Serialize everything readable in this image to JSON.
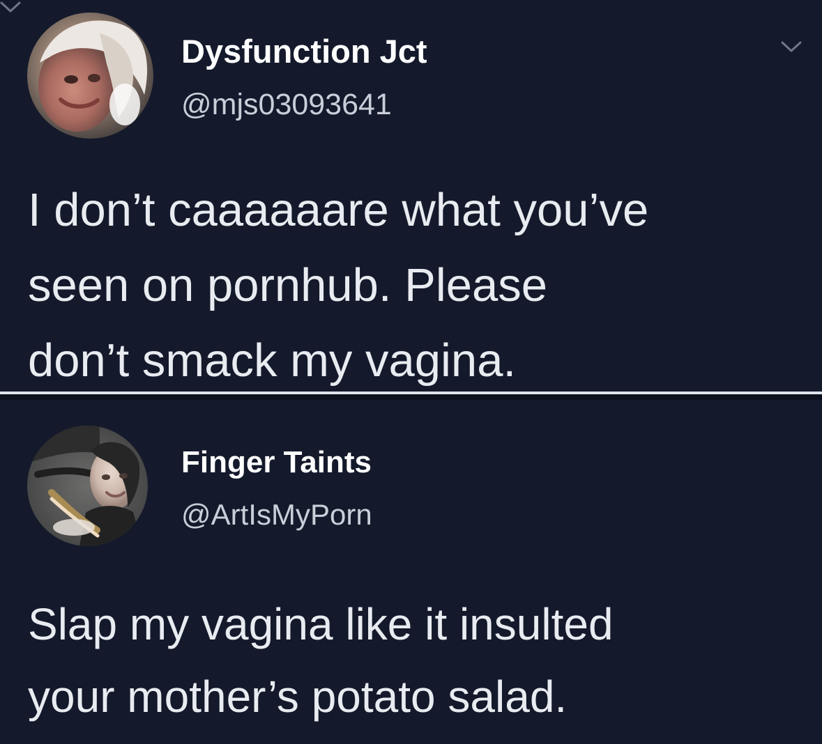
{
  "tweets": [
    {
      "display_name": "Dysfunction Jct",
      "handle": "@mjs03093641",
      "text_lines": [
        "I don’t caaaaaare what you’ve",
        "seen on pornhub.  Please",
        "don’t smack my vagina."
      ],
      "icons": {
        "avatar": "profile-photo",
        "menu": "chevron-down-icon"
      }
    },
    {
      "display_name": "Finger Taints",
      "handle": "@ArtIsMyPorn",
      "text_lines": [
        "Slap my vagina like it insulted",
        "your mother’s potato salad."
      ],
      "icons": {
        "avatar": "profile-photo",
        "menu": "chevron-down-icon"
      }
    }
  ],
  "colors": {
    "background": "#141a2b",
    "text_primary": "#e8ebf0",
    "text_secondary": "#c9cfd9",
    "divider": "#dfe3ea"
  }
}
